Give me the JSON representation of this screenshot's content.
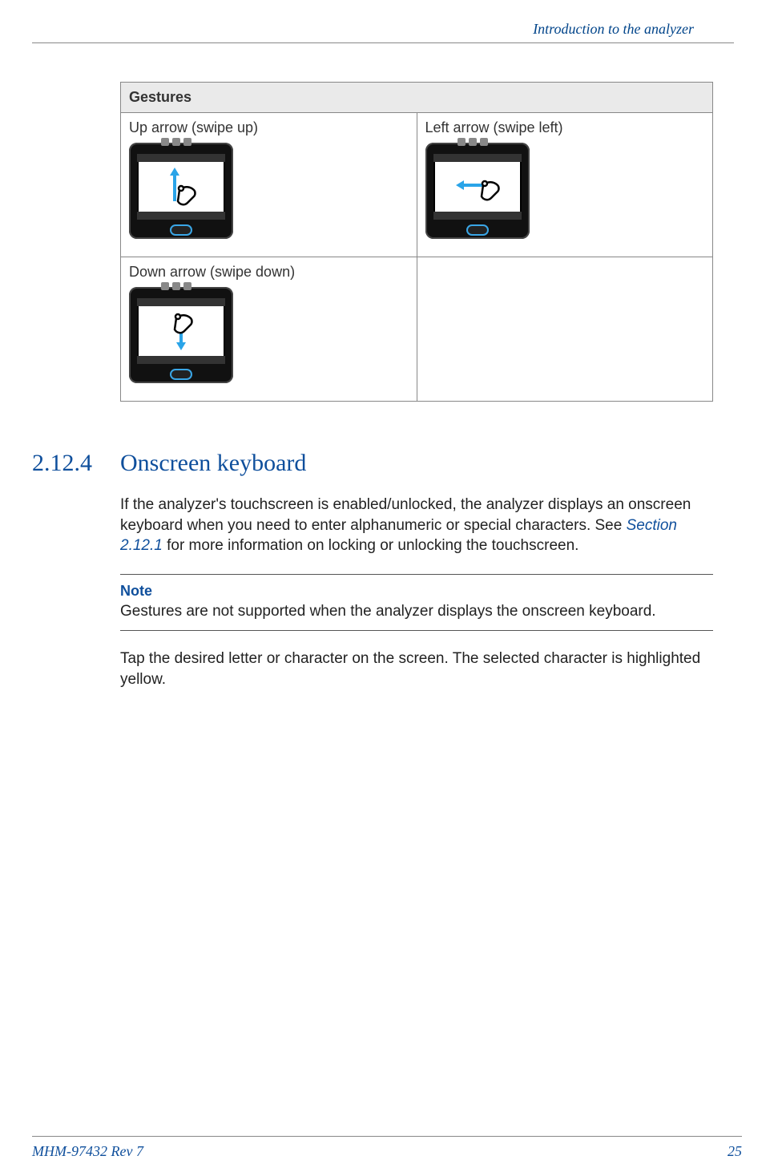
{
  "header": {
    "chapter": "Introduction to the analyzer"
  },
  "gestures": {
    "title": "Gestures",
    "cells": {
      "up": "Up arrow (swipe up)",
      "left": "Left arrow (swipe left)",
      "down": "Down arrow (swipe down)"
    }
  },
  "section": {
    "number": "2.12.4",
    "title": "Onscreen keyboard",
    "para1_a": "If the analyzer's touchscreen is enabled/unlocked, the analyzer displays an onscreen keyboard when you need to enter alphanumeric or special characters. See ",
    "para1_link": "Section 2.12.1",
    "para1_b": " for more information on locking or unlocking the touchscreen.",
    "note_label": "Note",
    "note_text": "Gestures are not supported when the analyzer displays the onscreen keyboard.",
    "para2": "Tap the desired letter or character on the screen. The selected character is highlighted yellow."
  },
  "footer": {
    "doc": "MHM-97432 Rev 7",
    "page": "25"
  }
}
